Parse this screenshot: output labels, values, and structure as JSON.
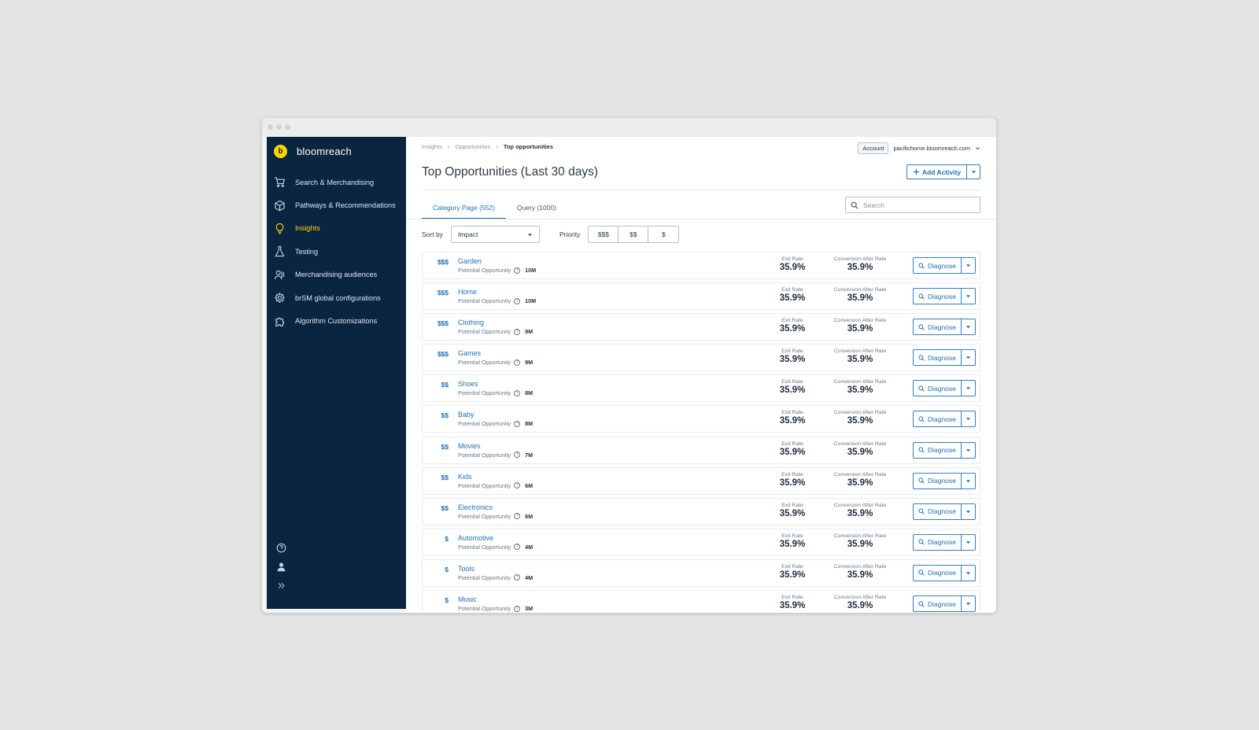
{
  "app": {
    "brand": "bloomreach",
    "logo_letter": "b"
  },
  "sidebar": {
    "items": [
      {
        "label": "Search & Merchandising",
        "icon": "cart-icon",
        "active": false
      },
      {
        "label": "Pathways & Recommendations",
        "icon": "cube-icon",
        "active": false
      },
      {
        "label": "Insights",
        "icon": "lightbulb-icon",
        "active": true
      },
      {
        "label": "Testing",
        "icon": "flask-icon",
        "active": false
      },
      {
        "label": "Merchandising audiences",
        "icon": "audience-icon",
        "active": false
      },
      {
        "label": "brSM global configurations",
        "icon": "gear-icon",
        "active": false
      },
      {
        "label": "Algorithm Customizations",
        "icon": "puzzle-icon",
        "active": false
      }
    ],
    "bottom_icons": [
      "help-icon",
      "user-icon",
      "expand-icon"
    ]
  },
  "breadcrumb": [
    "Insights",
    "Opportunities",
    "Top opportunities"
  ],
  "account": {
    "tag": "Account",
    "domain": "pacifichome.bloomreach.com"
  },
  "page": {
    "title": "Top Opportunities (Last 30 days)",
    "add_activity": "Add Activity"
  },
  "tabs": [
    {
      "label": "Category Page (552)",
      "active": true
    },
    {
      "label": "Query (1000)",
      "active": false
    }
  ],
  "search": {
    "placeholder": "Search"
  },
  "filters": {
    "sort_label": "Sort by",
    "sort_value": "Impact",
    "priority_label": "Priority",
    "priority_options": [
      "$$$",
      "$$",
      "$"
    ]
  },
  "columns": {
    "opportunity_label": "Potential Opportunity",
    "exit_rate_label": "Exit Rate",
    "conversion_label": "Conversion After Rate",
    "diagnose_label": "Diagnose"
  },
  "rows": [
    {
      "priority": "$$$",
      "name": "Garden",
      "opportunity": "10M",
      "exit_rate": "35.9%",
      "conversion": "35.9%"
    },
    {
      "priority": "$$$",
      "name": "Home",
      "opportunity": "10M",
      "exit_rate": "35.9%",
      "conversion": "35.9%"
    },
    {
      "priority": "$$$",
      "name": "Clothing",
      "opportunity": "9M",
      "exit_rate": "35.9%",
      "conversion": "35.9%"
    },
    {
      "priority": "$$$",
      "name": "Games",
      "opportunity": "9M",
      "exit_rate": "35.9%",
      "conversion": "35.9%"
    },
    {
      "priority": "$$",
      "name": "Shoes",
      "opportunity": "8M",
      "exit_rate": "35.9%",
      "conversion": "35.9%"
    },
    {
      "priority": "$$",
      "name": "Baby",
      "opportunity": "8M",
      "exit_rate": "35.9%",
      "conversion": "35.9%"
    },
    {
      "priority": "$$",
      "name": "Movies",
      "opportunity": "7M",
      "exit_rate": "35.9%",
      "conversion": "35.9%"
    },
    {
      "priority": "$$",
      "name": "Kids",
      "opportunity": "6M",
      "exit_rate": "35.9%",
      "conversion": "35.9%"
    },
    {
      "priority": "$$",
      "name": "Electronics",
      "opportunity": "6M",
      "exit_rate": "35.9%",
      "conversion": "35.9%"
    },
    {
      "priority": "$",
      "name": "Automotive",
      "opportunity": "4M",
      "exit_rate": "35.9%",
      "conversion": "35.9%"
    },
    {
      "priority": "$",
      "name": "Tools",
      "opportunity": "4M",
      "exit_rate": "35.9%",
      "conversion": "35.9%"
    },
    {
      "priority": "$",
      "name": "Music",
      "opportunity": "3M",
      "exit_rate": "35.9%",
      "conversion": "35.9%"
    }
  ],
  "colors": {
    "sidebar_bg": "#0a2540",
    "accent": "#1f6fb5",
    "active_nav": "#ffd500"
  }
}
